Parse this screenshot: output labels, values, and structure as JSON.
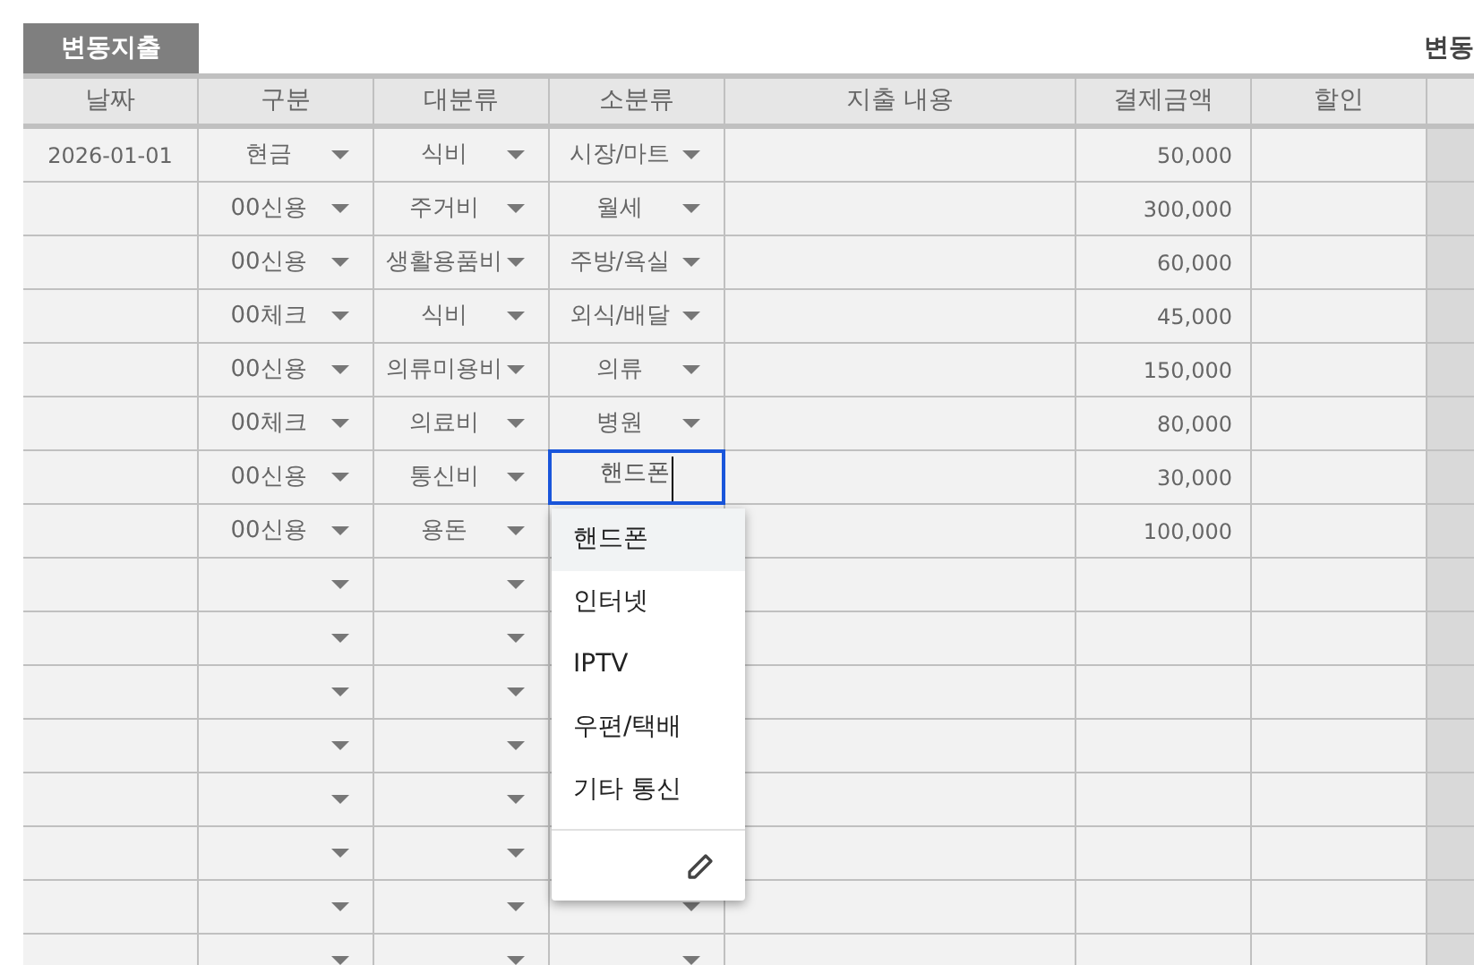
{
  "sheet_title": "변동지출",
  "right_title": "변동",
  "columns": [
    "날짜",
    "구분",
    "대분류",
    "소분류",
    "지출 내용",
    "결제금액",
    "할인"
  ],
  "rows": [
    {
      "date": "2026-01-01",
      "type": "현금",
      "category": "식비",
      "subcategory": "시장/마트",
      "amount": "50,000"
    },
    {
      "type": "00신용",
      "category": "주거비",
      "subcategory": "월세",
      "amount": "300,000"
    },
    {
      "type": "00신용",
      "category": "생활용품비",
      "subcategory": "주방/욕실",
      "amount": "60,000"
    },
    {
      "type": "00체크",
      "category": "식비",
      "subcategory": "외식/배달",
      "amount": "45,000"
    },
    {
      "type": "00신용",
      "category": "의류미용비",
      "subcategory": "의류",
      "amount": "150,000"
    },
    {
      "type": "00체크",
      "category": "의료비",
      "subcategory": "병원",
      "amount": "80,000"
    },
    {
      "type": "00신용",
      "category": "통신비",
      "subcategory": "핸드폰",
      "editing": true,
      "amount": "30,000"
    },
    {
      "type": "00신용",
      "category": "용돈",
      "amount": "100,000"
    }
  ],
  "dropdown": {
    "options": [
      {
        "label": "핸드폰",
        "selected": true
      },
      {
        "label": "인터넷",
        "selected": false
      },
      {
        "label": "IPTV",
        "selected": false
      },
      {
        "label": "우편/택배",
        "selected": false
      },
      {
        "label": "기타 통신",
        "selected": false
      }
    ]
  }
}
